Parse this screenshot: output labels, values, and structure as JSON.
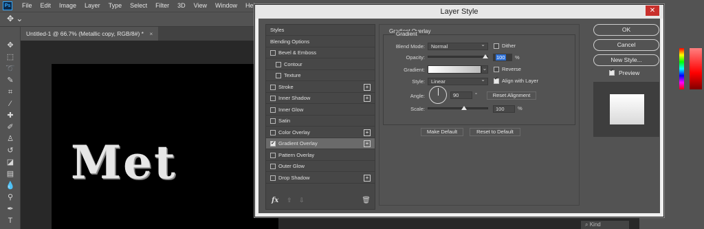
{
  "app": {
    "logo": "Ps",
    "menu": [
      "File",
      "Edit",
      "Image",
      "Layer",
      "Type",
      "Select",
      "Filter",
      "3D",
      "View",
      "Window",
      "Help"
    ]
  },
  "document": {
    "tab_title": "Untitled-1 @ 66.7% (Metallic copy, RGB/8#) *",
    "tab_close": "×",
    "canvas_text": "Met"
  },
  "layers_filter": {
    "kind_label": "Kind"
  },
  "dialog": {
    "title": "Layer Style",
    "close_glyph": "✕",
    "styles_list": [
      {
        "label": "Styles",
        "checkbox": false,
        "checked": false,
        "plus": false,
        "indent": 0
      },
      {
        "label": "Blending Options",
        "checkbox": false,
        "checked": false,
        "plus": false,
        "indent": 0
      },
      {
        "label": "Bevel & Emboss",
        "checkbox": true,
        "checked": false,
        "plus": false,
        "indent": 0
      },
      {
        "label": "Contour",
        "checkbox": true,
        "checked": false,
        "plus": false,
        "indent": 1
      },
      {
        "label": "Texture",
        "checkbox": true,
        "checked": false,
        "plus": false,
        "indent": 1
      },
      {
        "label": "Stroke",
        "checkbox": true,
        "checked": false,
        "plus": true,
        "indent": 0
      },
      {
        "label": "Inner Shadow",
        "checkbox": true,
        "checked": false,
        "plus": true,
        "indent": 0
      },
      {
        "label": "Inner Glow",
        "checkbox": true,
        "checked": false,
        "plus": false,
        "indent": 0
      },
      {
        "label": "Satin",
        "checkbox": true,
        "checked": false,
        "plus": false,
        "indent": 0
      },
      {
        "label": "Color Overlay",
        "checkbox": true,
        "checked": false,
        "plus": true,
        "indent": 0
      },
      {
        "label": "Gradient Overlay",
        "checkbox": true,
        "checked": true,
        "plus": true,
        "indent": 0,
        "selected": true
      },
      {
        "label": "Pattern Overlay",
        "checkbox": true,
        "checked": false,
        "plus": false,
        "indent": 0
      },
      {
        "label": "Outer Glow",
        "checkbox": true,
        "checked": false,
        "plus": false,
        "indent": 0
      },
      {
        "label": "Drop Shadow",
        "checkbox": true,
        "checked": false,
        "plus": true,
        "indent": 0
      }
    ],
    "footer_fx": "fx",
    "gradient_overlay": {
      "title": "Gradient Overlay",
      "subtitle": "Gradient",
      "blend_mode_label": "Blend Mode:",
      "blend_mode_value": "Normal",
      "dither_label": "Dither",
      "dither_checked": false,
      "opacity_label": "Opacity:",
      "opacity_value": "100",
      "opacity_unit": "%",
      "opacity_fraction": 1.0,
      "gradient_label": "Gradient:",
      "reverse_label": "Reverse",
      "reverse_checked": false,
      "style_label": "Style:",
      "style_value": "Linear",
      "align_label": "Align with Layer",
      "align_checked": true,
      "angle_label": "Angle:",
      "angle_value": "90",
      "angle_unit": "°",
      "reset_alignment": "Reset Alignment",
      "scale_label": "Scale:",
      "scale_value": "100",
      "scale_unit": "%",
      "make_default": "Make Default",
      "reset_to_default": "Reset to Default"
    },
    "buttons": {
      "ok": "OK",
      "cancel": "Cancel",
      "new_style": "New Style...",
      "preview_label": "Preview",
      "preview_checked": true
    }
  }
}
